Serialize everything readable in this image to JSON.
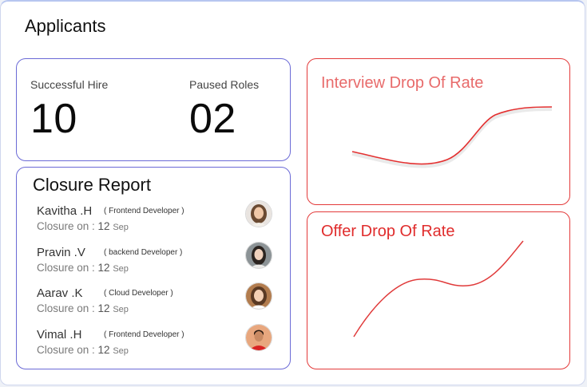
{
  "page": {
    "title": "Applicants"
  },
  "stats": [
    {
      "label": "Successful Hire",
      "value": "10"
    },
    {
      "label": "Paused Roles",
      "value": "02"
    }
  ],
  "closure_report": {
    "title": "Closure Report",
    "prefix": "Closure on : ",
    "rows": [
      {
        "name": "Kavitha .H",
        "role": "( Frontend Developer )",
        "date_num": "12",
        "date_month": "Sep"
      },
      {
        "name": "Pravin .V",
        "role": "( backend Developer )",
        "date_num": "12",
        "date_month": "Sep"
      },
      {
        "name": "Aarav .K",
        "role": "( Cloud Developer )",
        "date_num": "12",
        "date_month": "Sep"
      },
      {
        "name": "Vimal .H",
        "role": "( Frontend Developer )",
        "date_num": "12",
        "date_month": "Sep"
      }
    ]
  },
  "charts": {
    "interview": {
      "title": "Interview  Drop Of Rate",
      "color": "#e33030"
    },
    "offer": {
      "title": "Offer  Drop Of Rate",
      "color": "#e03a3a"
    }
  },
  "colors": {
    "card_blue_border": "#6b6ad6",
    "card_red_border": "#e33a3a"
  }
}
